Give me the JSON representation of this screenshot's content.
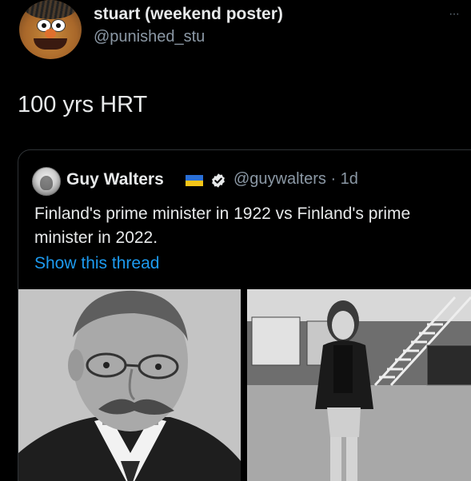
{
  "tweet": {
    "display_name": "stuart (weekend poster)",
    "handle": "@punished_stu",
    "more_label": "···",
    "text": "100 yrs HRT"
  },
  "quoted": {
    "display_name": "Guy Walters",
    "handle_time": "@guywalters · 1d",
    "text": "Finland's prime minister in 1922 vs Finland's prime minister in 2022.",
    "show_thread": "Show this thread",
    "flag_colors": {
      "top": "#2a6fd6",
      "bottom": "#f5c518"
    }
  },
  "colors": {
    "background": "#000000",
    "text_primary": "#e7e9ea",
    "text_secondary": "#8b98a5",
    "link": "#1d9bf0",
    "border": "#2f3336"
  },
  "icons": {
    "avatar": "puppet-avatar",
    "more": "more-horizontal-icon",
    "verified": "verified-badge-icon",
    "flag": "ukraine-flag-icon"
  }
}
